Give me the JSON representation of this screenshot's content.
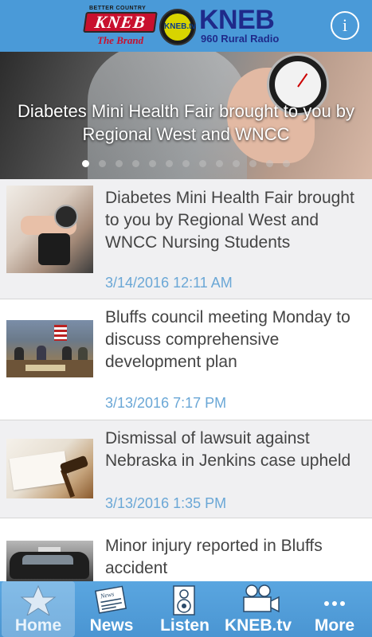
{
  "header": {
    "logo": {
      "better_country": "BETTER COUNTRY",
      "kneb_red": "KNEB",
      "the_brand": "The Brand",
      "kneb_tv": "KNEB.tv",
      "kneb_big": "KNEB",
      "station": "960 Rural Radio"
    },
    "info_label": "i"
  },
  "hero": {
    "title": "Diabetes Mini Health Fair brought to you by Regional West and WNCC",
    "slide_count": 13,
    "active_slide": 1
  },
  "articles": [
    {
      "title": "Diabetes Mini Health Fair brought to you by Regional West and WNCC Nursing Students",
      "date": "3/14/2016 12:11 AM",
      "thumb": "blood-pressure-photo"
    },
    {
      "title": "Bluffs council meeting Monday to discuss comprehensive development plan",
      "date": "3/13/2016 7:17 PM",
      "thumb": "council-meeting-photo"
    },
    {
      "title": "Dismissal of lawsuit against Nebraska in Jenkins case upheld",
      "date": "3/13/2016 1:35 PM",
      "thumb": "gavel-photo"
    },
    {
      "title": "Minor injury reported in Bluffs accident",
      "date": "",
      "thumb": "police-car-photo"
    }
  ],
  "tabs": [
    {
      "label": "Home",
      "icon": "star-icon",
      "active": true
    },
    {
      "label": "News",
      "icon": "newspaper-icon",
      "active": false
    },
    {
      "label": "Listen",
      "icon": "speaker-icon",
      "active": false
    },
    {
      "label": "KNEB.tv",
      "icon": "video-camera-icon",
      "active": false
    },
    {
      "label": "More",
      "icon": "ellipsis-icon",
      "active": false
    }
  ],
  "colors": {
    "header_blue": "#4a9ad8",
    "tabbar_blue": "#4a95d2",
    "date_blue": "#6aa7d6",
    "title_gray": "#444444"
  }
}
